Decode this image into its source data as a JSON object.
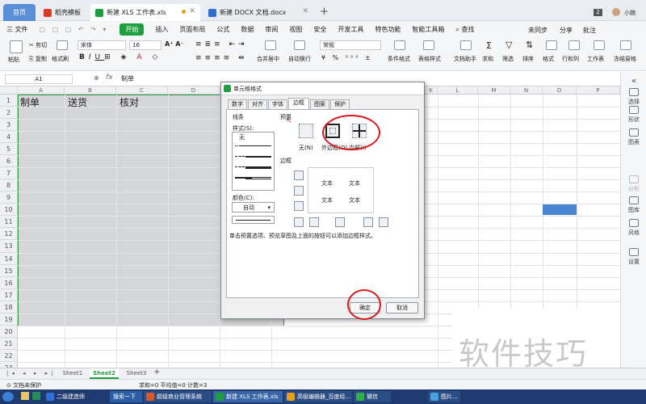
{
  "tabs": [
    {
      "label": "首页"
    },
    {
      "label": "稻壳模板"
    },
    {
      "label": "新建 XLS 工作表.xls"
    },
    {
      "label": "新建 DOCX 文档.docx"
    }
  ],
  "user": {
    "badge": "2",
    "name": "小婉"
  },
  "menu": {
    "file": "三 文件",
    "start": "开始",
    "items": [
      "插入",
      "页面布局",
      "公式",
      "数据",
      "审阅",
      "视图",
      "安全",
      "开发工具",
      "特色功能",
      "智能工具箱"
    ],
    "search": "查找",
    "unsync": "未同步",
    "share": "分享",
    "annotate": "批注"
  },
  "toolbar": {
    "paste": "粘贴",
    "cut": "剪切",
    "copy": "复制",
    "format_painter": "格式刷",
    "font": "宋体",
    "size": "16",
    "merge": "合并居中",
    "wrap": "自动换行",
    "number_format": "常规",
    "cond_format": "条件格式",
    "table_style": "表格样式",
    "doc_helper": "文档助手",
    "sum": "求和",
    "filter": "筛选",
    "sort": "排序",
    "format": "格式",
    "rowcol": "行和列",
    "worksheet": "工作表",
    "freeze": "冻结窗格"
  },
  "formula": {
    "cell_ref": "A1",
    "fx": "fx",
    "value": "制单"
  },
  "grid": {
    "columns": [
      "A",
      "B",
      "C",
      "D",
      "E",
      "K",
      "L",
      "M",
      "N",
      "O",
      "P"
    ],
    "rows": [
      "1",
      "2",
      "3",
      "4",
      "5",
      "6",
      "7",
      "8",
      "9",
      "10",
      "11",
      "12",
      "13",
      "14",
      "15",
      "16",
      "17",
      "18",
      "19",
      "20",
      "21",
      "22",
      "23"
    ],
    "cells": [
      "制单",
      "送货",
      "核对"
    ]
  },
  "right_panel": [
    "选择",
    "形状",
    "图表",
    "分析",
    "图库",
    "风格",
    "设置"
  ],
  "dialog": {
    "title": "单元格格式",
    "tabs": [
      "数字",
      "对齐",
      "字体",
      "边框",
      "图案",
      "保护"
    ],
    "line_group": "线条",
    "style_label": "样式(S):",
    "none_label": "无",
    "color_label": "颜色(C):",
    "color_value": "自动",
    "preset_group": "预置",
    "presets": [
      "无(N)",
      "外边框(O)",
      "内部(I)"
    ],
    "border_group": "边框",
    "preview_text": [
      "文本",
      "文本",
      "文本",
      "文本"
    ],
    "hint": "单击预置选项、预览草图及上面的按钮可以添加边框样式。",
    "ok": "确定",
    "cancel": "取消"
  },
  "sheets": [
    "Sheet1",
    "Sheet2",
    "Sheet3"
  ],
  "status": {
    "protect": "文档未保护",
    "stats": "求和=0  平均值=0  计数=3"
  },
  "taskbar": [
    {
      "label": "二级建造师"
    },
    {
      "label": "搜索一下"
    },
    {
      "label": "超级商业管理系统"
    },
    {
      "label": "新建 XLS 工作表.xls"
    },
    {
      "label": "高级编辑器_百度经..."
    },
    {
      "label": "微信"
    },
    {
      "label": "图片..."
    }
  ],
  "watermark": "软件技巧",
  "colors": {
    "accent": "#1e9e3f",
    "selection_border": "#2a9a3a",
    "highlight_cell": "#4a86d0",
    "annotation": "#d8191f",
    "taskbar": "#1e3a6e"
  }
}
